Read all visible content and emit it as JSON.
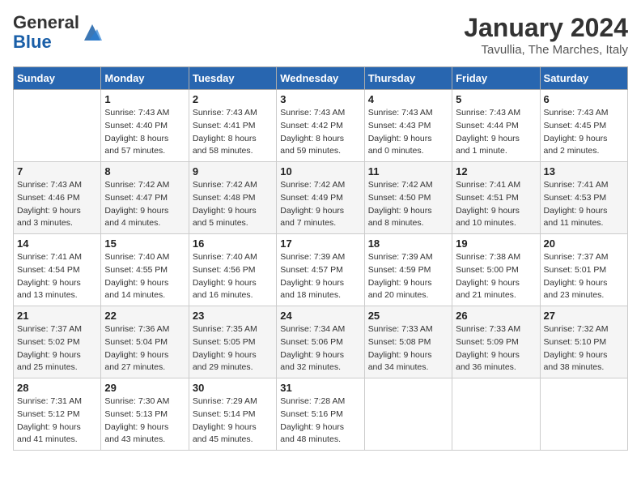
{
  "header": {
    "logo_general": "General",
    "logo_blue": "Blue",
    "month_title": "January 2024",
    "location": "Tavullia, The Marches, Italy"
  },
  "weekdays": [
    "Sunday",
    "Monday",
    "Tuesday",
    "Wednesday",
    "Thursday",
    "Friday",
    "Saturday"
  ],
  "weeks": [
    [
      {
        "day": "",
        "info": ""
      },
      {
        "day": "1",
        "info": "Sunrise: 7:43 AM\nSunset: 4:40 PM\nDaylight: 8 hours\nand 57 minutes."
      },
      {
        "day": "2",
        "info": "Sunrise: 7:43 AM\nSunset: 4:41 PM\nDaylight: 8 hours\nand 58 minutes."
      },
      {
        "day": "3",
        "info": "Sunrise: 7:43 AM\nSunset: 4:42 PM\nDaylight: 8 hours\nand 59 minutes."
      },
      {
        "day": "4",
        "info": "Sunrise: 7:43 AM\nSunset: 4:43 PM\nDaylight: 9 hours\nand 0 minutes."
      },
      {
        "day": "5",
        "info": "Sunrise: 7:43 AM\nSunset: 4:44 PM\nDaylight: 9 hours\nand 1 minute."
      },
      {
        "day": "6",
        "info": "Sunrise: 7:43 AM\nSunset: 4:45 PM\nDaylight: 9 hours\nand 2 minutes."
      }
    ],
    [
      {
        "day": "7",
        "info": "Sunrise: 7:43 AM\nSunset: 4:46 PM\nDaylight: 9 hours\nand 3 minutes."
      },
      {
        "day": "8",
        "info": "Sunrise: 7:42 AM\nSunset: 4:47 PM\nDaylight: 9 hours\nand 4 minutes."
      },
      {
        "day": "9",
        "info": "Sunrise: 7:42 AM\nSunset: 4:48 PM\nDaylight: 9 hours\nand 5 minutes."
      },
      {
        "day": "10",
        "info": "Sunrise: 7:42 AM\nSunset: 4:49 PM\nDaylight: 9 hours\nand 7 minutes."
      },
      {
        "day": "11",
        "info": "Sunrise: 7:42 AM\nSunset: 4:50 PM\nDaylight: 9 hours\nand 8 minutes."
      },
      {
        "day": "12",
        "info": "Sunrise: 7:41 AM\nSunset: 4:51 PM\nDaylight: 9 hours\nand 10 minutes."
      },
      {
        "day": "13",
        "info": "Sunrise: 7:41 AM\nSunset: 4:53 PM\nDaylight: 9 hours\nand 11 minutes."
      }
    ],
    [
      {
        "day": "14",
        "info": "Sunrise: 7:41 AM\nSunset: 4:54 PM\nDaylight: 9 hours\nand 13 minutes."
      },
      {
        "day": "15",
        "info": "Sunrise: 7:40 AM\nSunset: 4:55 PM\nDaylight: 9 hours\nand 14 minutes."
      },
      {
        "day": "16",
        "info": "Sunrise: 7:40 AM\nSunset: 4:56 PM\nDaylight: 9 hours\nand 16 minutes."
      },
      {
        "day": "17",
        "info": "Sunrise: 7:39 AM\nSunset: 4:57 PM\nDaylight: 9 hours\nand 18 minutes."
      },
      {
        "day": "18",
        "info": "Sunrise: 7:39 AM\nSunset: 4:59 PM\nDaylight: 9 hours\nand 20 minutes."
      },
      {
        "day": "19",
        "info": "Sunrise: 7:38 AM\nSunset: 5:00 PM\nDaylight: 9 hours\nand 21 minutes."
      },
      {
        "day": "20",
        "info": "Sunrise: 7:37 AM\nSunset: 5:01 PM\nDaylight: 9 hours\nand 23 minutes."
      }
    ],
    [
      {
        "day": "21",
        "info": "Sunrise: 7:37 AM\nSunset: 5:02 PM\nDaylight: 9 hours\nand 25 minutes."
      },
      {
        "day": "22",
        "info": "Sunrise: 7:36 AM\nSunset: 5:04 PM\nDaylight: 9 hours\nand 27 minutes."
      },
      {
        "day": "23",
        "info": "Sunrise: 7:35 AM\nSunset: 5:05 PM\nDaylight: 9 hours\nand 29 minutes."
      },
      {
        "day": "24",
        "info": "Sunrise: 7:34 AM\nSunset: 5:06 PM\nDaylight: 9 hours\nand 32 minutes."
      },
      {
        "day": "25",
        "info": "Sunrise: 7:33 AM\nSunset: 5:08 PM\nDaylight: 9 hours\nand 34 minutes."
      },
      {
        "day": "26",
        "info": "Sunrise: 7:33 AM\nSunset: 5:09 PM\nDaylight: 9 hours\nand 36 minutes."
      },
      {
        "day": "27",
        "info": "Sunrise: 7:32 AM\nSunset: 5:10 PM\nDaylight: 9 hours\nand 38 minutes."
      }
    ],
    [
      {
        "day": "28",
        "info": "Sunrise: 7:31 AM\nSunset: 5:12 PM\nDaylight: 9 hours\nand 41 minutes."
      },
      {
        "day": "29",
        "info": "Sunrise: 7:30 AM\nSunset: 5:13 PM\nDaylight: 9 hours\nand 43 minutes."
      },
      {
        "day": "30",
        "info": "Sunrise: 7:29 AM\nSunset: 5:14 PM\nDaylight: 9 hours\nand 45 minutes."
      },
      {
        "day": "31",
        "info": "Sunrise: 7:28 AM\nSunset: 5:16 PM\nDaylight: 9 hours\nand 48 minutes."
      },
      {
        "day": "",
        "info": ""
      },
      {
        "day": "",
        "info": ""
      },
      {
        "day": "",
        "info": ""
      }
    ]
  ]
}
